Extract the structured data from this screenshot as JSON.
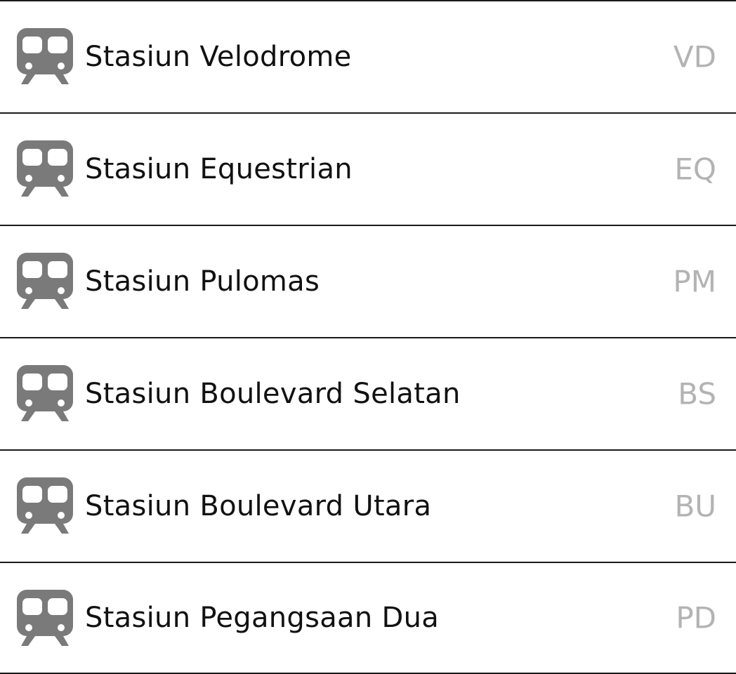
{
  "station_list": {
    "items": [
      {
        "name": "Stasiun Velodrome",
        "code": "VD",
        "icon": "train-icon"
      },
      {
        "name": "Stasiun Equestrian",
        "code": "EQ",
        "icon": "train-icon"
      },
      {
        "name": "Stasiun Pulomas",
        "code": "PM",
        "icon": "train-icon"
      },
      {
        "name": "Stasiun Boulevard Selatan",
        "code": "BS",
        "icon": "train-icon"
      },
      {
        "name": "Stasiun Boulevard Utara",
        "code": "BU",
        "icon": "train-icon"
      },
      {
        "name": "Stasiun Pegangsaan Dua",
        "code": "PD",
        "icon": "train-icon"
      }
    ]
  },
  "colors": {
    "icon": "#7a7a7a",
    "name_text": "#111111",
    "code_text": "#b3b3b3",
    "divider": "#1a1a1a"
  }
}
